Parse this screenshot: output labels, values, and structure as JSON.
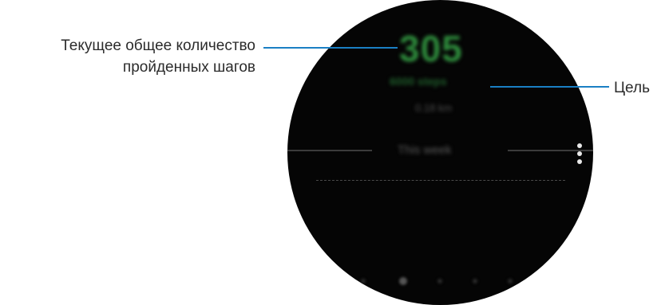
{
  "screen": {
    "step_count": "305",
    "goal_text": "6000 steps",
    "distance_text": "0.18 km",
    "week_label": "This week",
    "more_icon": "more-vertical-icon",
    "day_indicator_count": 5,
    "current_day_index": 1,
    "accent_color": "#2e8b3c"
  },
  "callouts": {
    "current_steps_line1": "Текущее общее количество",
    "current_steps_line2": "пройденных шагов",
    "goal_label": "Цель",
    "line_color": "#1a7fc4"
  }
}
